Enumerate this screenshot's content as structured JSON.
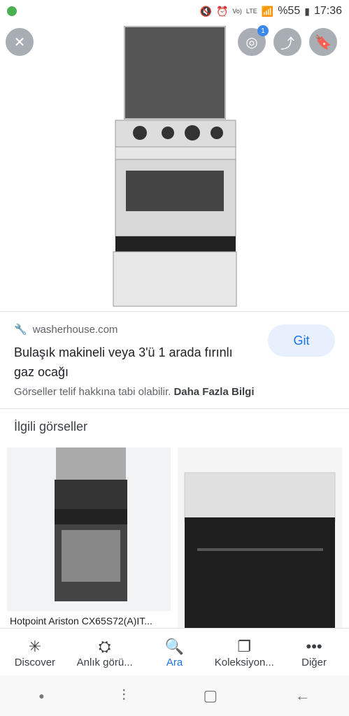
{
  "status": {
    "time": "17:36",
    "battery": "%55",
    "network_labels": [
      "Vo)",
      "LTE"
    ]
  },
  "hero": {
    "close_icon": "close-icon",
    "lens_badge": "1",
    "share_icon": "share-icon",
    "bookmark_icon": "bookmark-icon"
  },
  "result": {
    "source": "washerhouse.com",
    "title": "Bulaşık makineli veya 3'ü 1 arada fırınlı gaz ocağı",
    "visit_label": "Git",
    "copyright_text": "Görseller telif hakkına tabi olabilir.",
    "more_info": "Daha Fazla Bilgi"
  },
  "related": {
    "heading": "İlgili görseller",
    "items": [
      {
        "caption": "Hotpoint Ariston CX65S72(A)IT..."
      },
      {
        "caption": ""
      }
    ]
  },
  "bottom_nav": [
    {
      "label": "Discover",
      "icon": "asterisk-icon"
    },
    {
      "label": "Anlık görü...",
      "icon": "updates-icon"
    },
    {
      "label": "Ara",
      "icon": "search-icon"
    },
    {
      "label": "Koleksiyon...",
      "icon": "collections-icon"
    },
    {
      "label": "Diğer",
      "icon": "more-icon"
    }
  ],
  "colors": {
    "accent": "#1a73e8",
    "chip_bg": "#e8f0fe"
  }
}
